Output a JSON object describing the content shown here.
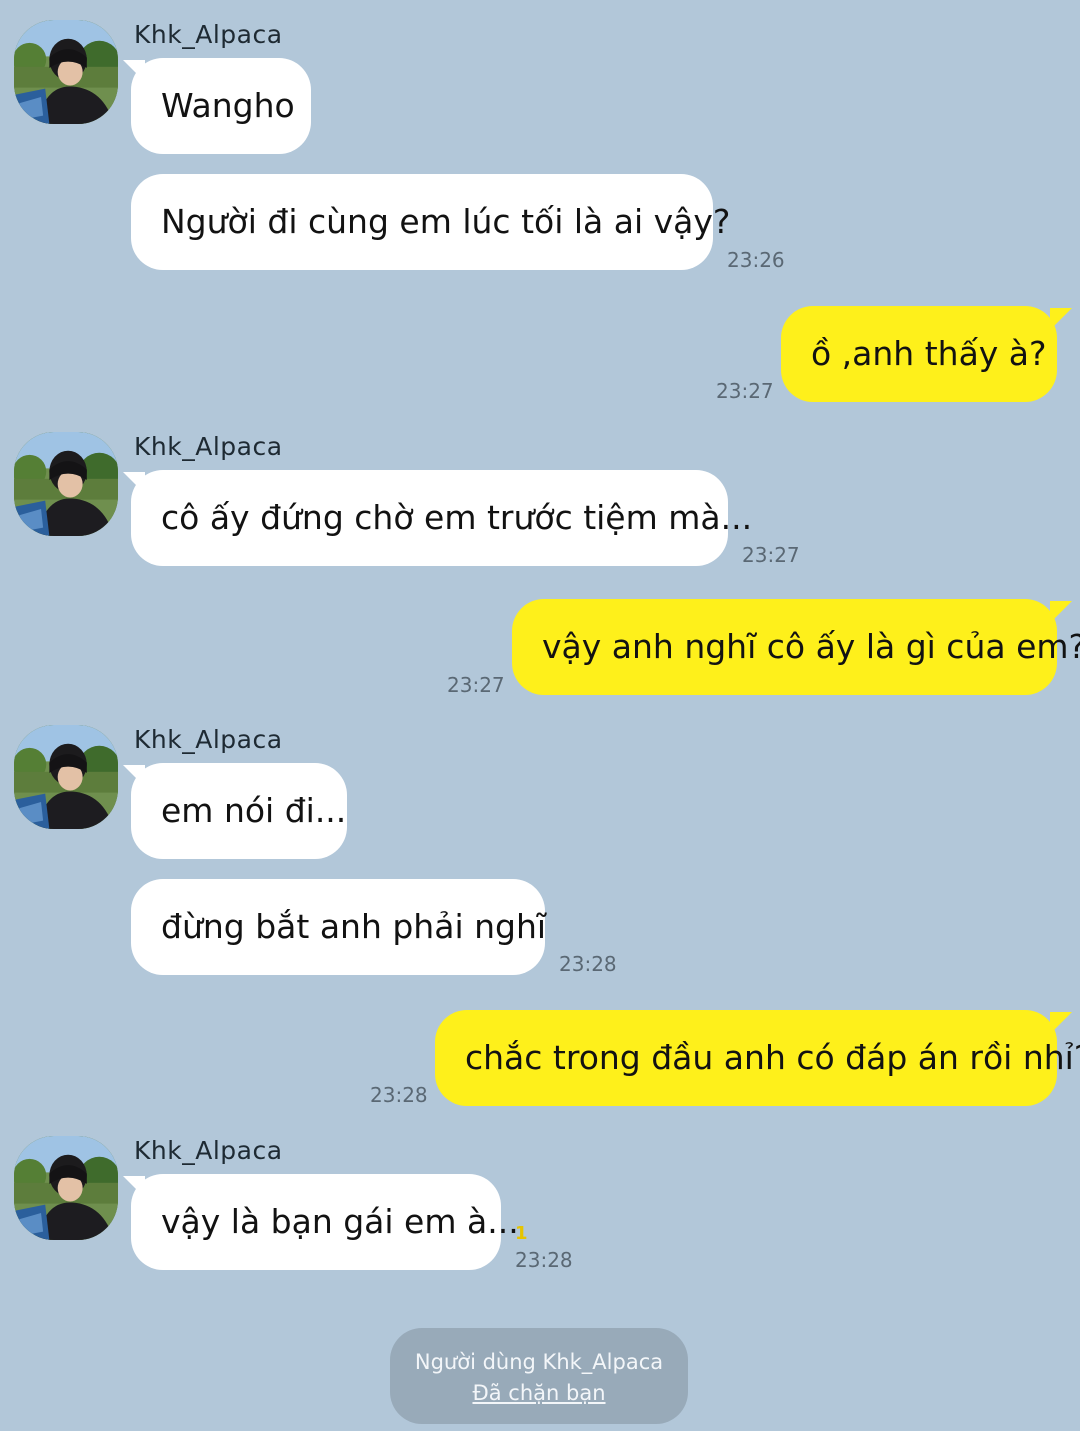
{
  "chat": {
    "messages": [
      {
        "sender": "Khk_Alpaca",
        "text": "Wangho"
      },
      {
        "sender": "Khk_Alpaca",
        "text": "Người đi cùng em lúc tối là ai vậy?",
        "time": "23:26"
      },
      {
        "sender": "me",
        "text": "ồ ,anh thấy à?",
        "time": "23:27"
      },
      {
        "sender": "Khk_Alpaca",
        "text": "cô ấy đứng chờ em trước tiệm mà...",
        "time": "23:27"
      },
      {
        "sender": "me",
        "text": "vậy anh nghĩ cô ấy là gì của em?",
        "time": "23:27"
      },
      {
        "sender": "Khk_Alpaca",
        "text": "em nói đi..."
      },
      {
        "sender": "Khk_Alpaca",
        "text": "đừng bắt anh phải nghĩ",
        "time": "23:28"
      },
      {
        "sender": "me",
        "text": "chắc trong đầu anh có đáp án rồi nhỉ?",
        "time": "23:28"
      },
      {
        "sender": "Khk_Alpaca",
        "text": "vậy là bạn gái em à...",
        "time": "23:28",
        "unread": "1"
      }
    ]
  },
  "notice": {
    "line1": "Người dùng Khk_Alpaca",
    "line2": "Đã chặn bạn"
  },
  "colors": {
    "background": "#b2c7d9",
    "incoming_bubble": "#ffffff",
    "outgoing_bubble": "#fef01b",
    "notice": "#98aab9"
  }
}
